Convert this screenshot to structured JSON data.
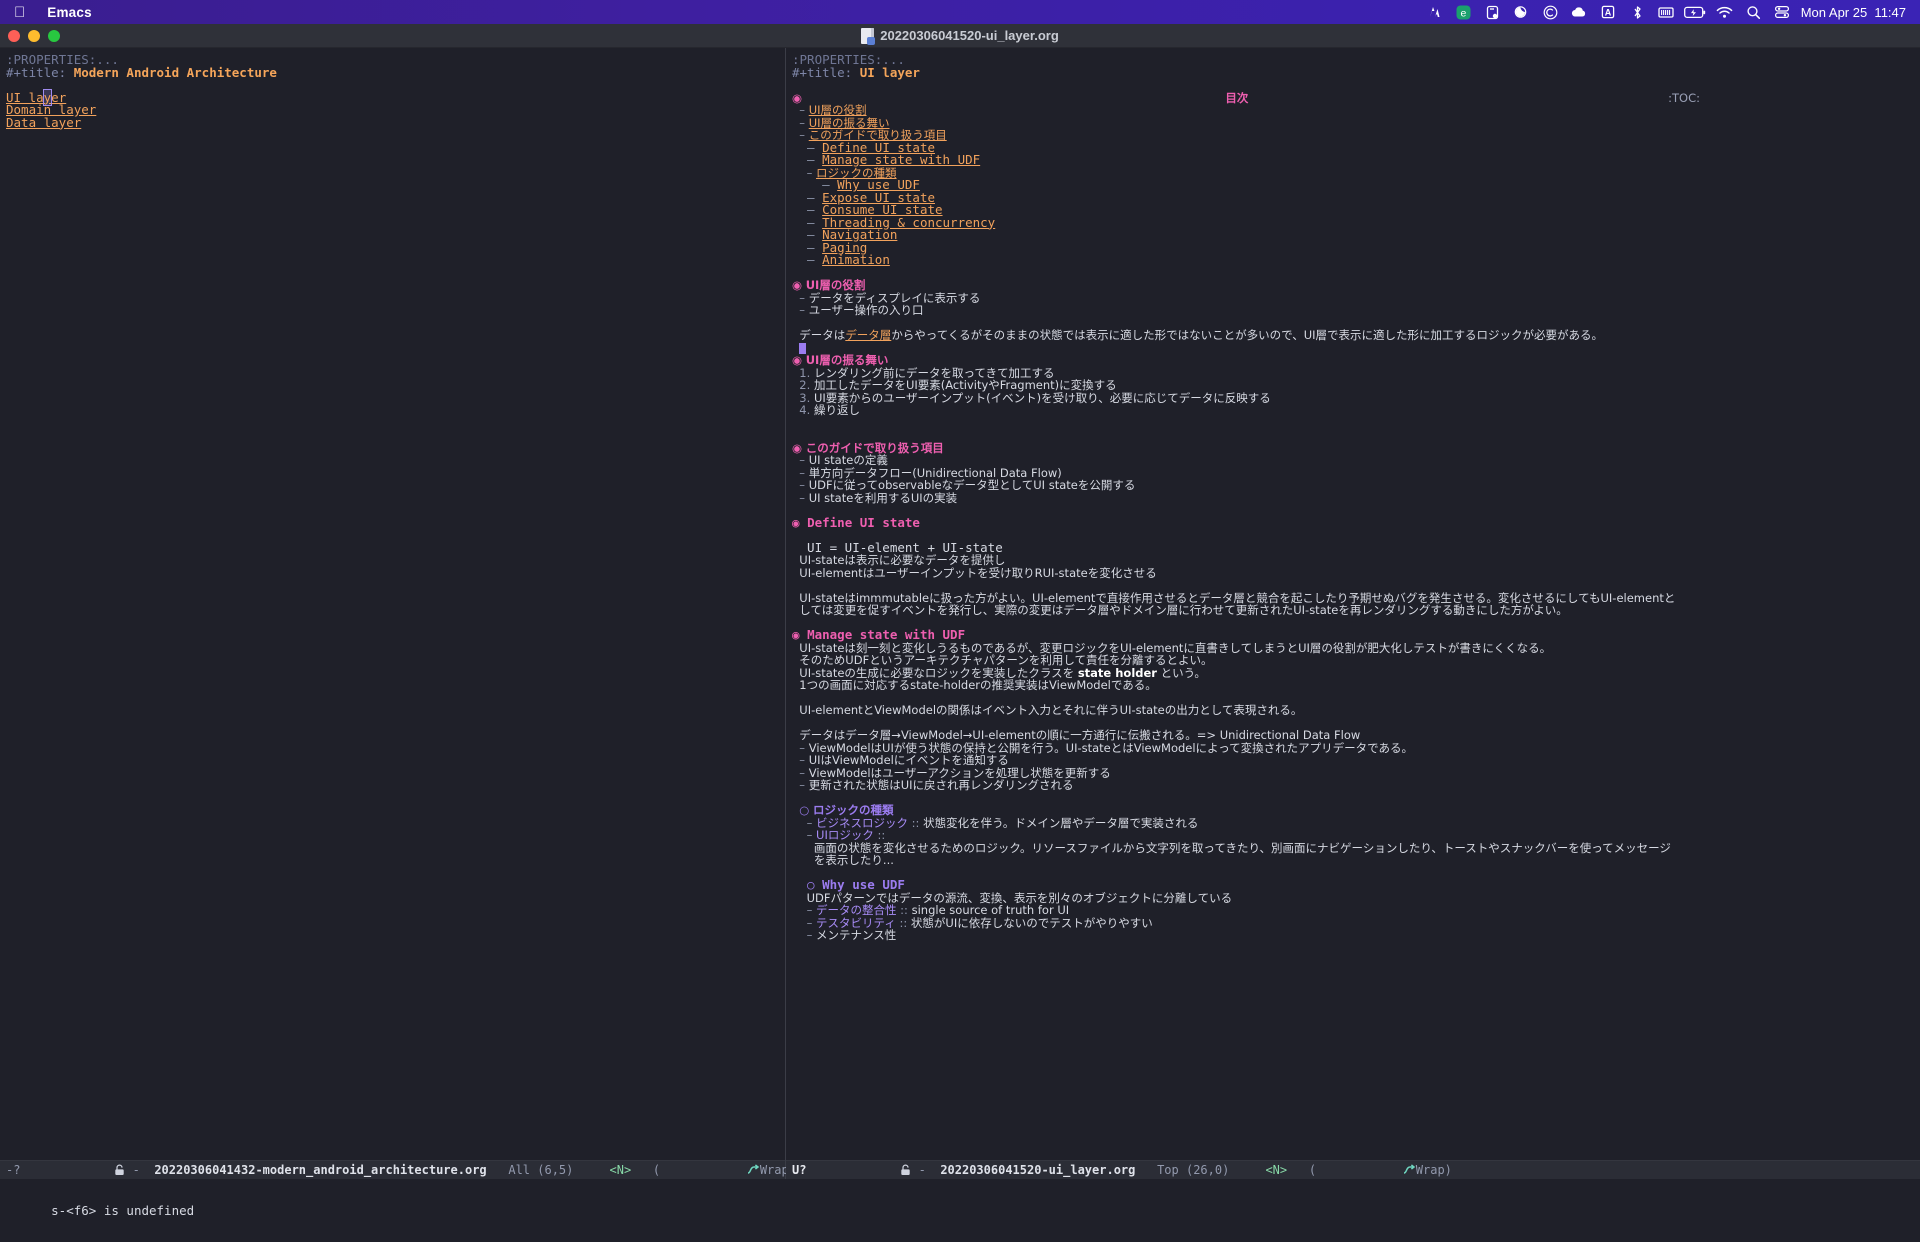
{
  "menubar": {
    "apple_glyph": "",
    "app_name": "Emacs",
    "tray_icons": [
      {
        "name": "sound-meter-icon",
        "glyph": "ᵚ"
      },
      {
        "name": "evernote-icon",
        "glyph": "e"
      },
      {
        "name": "clipboard-icon",
        "glyph": "▯"
      },
      {
        "name": "moon-icon",
        "glyph": "◖"
      },
      {
        "name": "creative-cloud-icon",
        "glyph": "Ⓒ"
      },
      {
        "name": "dropbox-icon",
        "glyph": "☁"
      },
      {
        "name": "input-source-icon",
        "glyph": "A"
      },
      {
        "name": "bluetooth-icon",
        "glyph": "✶"
      },
      {
        "name": "keyboard-brightness-icon",
        "glyph": "⌸"
      },
      {
        "name": "battery-icon",
        "glyph": "▭"
      },
      {
        "name": "wifi-icon",
        "glyph": "◠"
      },
      {
        "name": "spotlight-search-icon",
        "glyph": "⚲"
      },
      {
        "name": "control-center-icon",
        "glyph": "☰"
      }
    ],
    "clock": "Mon Apr 25  11:47"
  },
  "titlebar": {
    "title": "20220306041520-ui_layer.org",
    "traffic_lights": [
      "close",
      "minimize",
      "zoom"
    ]
  },
  "left_window": {
    "lines": [
      {
        "segs": [
          {
            "t": ":PROPERTIES:...",
            "c": "f-prop"
          }
        ]
      },
      {
        "segs": [
          {
            "t": "#+title: ",
            "c": "f-kw"
          },
          {
            "t": "Modern Android Architecture",
            "c": "f-title"
          }
        ]
      },
      {
        "segs": [
          {
            "t": "",
            "c": "f-plain"
          }
        ]
      },
      {
        "segs": [
          {
            "t": "UI la",
            "c": "f-link"
          },
          {
            "t": "y",
            "c": "f-link caret-box"
          },
          {
            "t": "er",
            "c": "f-link"
          }
        ]
      },
      {
        "segs": [
          {
            "t": "Domain layer",
            "c": "f-link"
          }
        ]
      },
      {
        "segs": [
          {
            "t": "Data layer",
            "c": "f-link"
          }
        ]
      }
    ],
    "modeline": {
      "flags": "-?",
      "lock": "🔓",
      "sep": "-",
      "buffer": "20220306041432-modern_android_architecture.org",
      "position": "All (6,5)",
      "evil_state": "<N>",
      "minor": "Wrap"
    }
  },
  "right_window": {
    "toc_marker": ":TOC:",
    "lines": [
      {
        "segs": [
          {
            "t": ":PROPERTIES:...",
            "c": "f-prop"
          }
        ]
      },
      {
        "segs": [
          {
            "t": "#+title: ",
            "c": "f-kw"
          },
          {
            "t": "UI layer",
            "c": "f-title"
          }
        ]
      },
      {
        "segs": [
          {
            "t": ""
          }
        ]
      },
      {
        "segs": [
          {
            "t": "◉ ",
            "c": "f-bullet"
          },
          {
            "t": "目次",
            "c": "f-h1"
          }
        ],
        "jp": true,
        "toc": true
      },
      {
        "segs": [
          {
            "t": "  – ",
            "c": "f-dash"
          },
          {
            "t": "UI層の役割",
            "c": "f-link"
          }
        ],
        "jp": true
      },
      {
        "segs": [
          {
            "t": "  – ",
            "c": "f-dash"
          },
          {
            "t": "UI層の振る舞い",
            "c": "f-link"
          }
        ],
        "jp": true
      },
      {
        "segs": [
          {
            "t": "  – ",
            "c": "f-dash"
          },
          {
            "t": "このガイドで取り扱う項目",
            "c": "f-link"
          }
        ],
        "jp": true
      },
      {
        "segs": [
          {
            "t": "  – ",
            "c": "f-dash"
          },
          {
            "t": "Define UI state",
            "c": "f-link"
          }
        ]
      },
      {
        "segs": [
          {
            "t": "  – ",
            "c": "f-dash"
          },
          {
            "t": "Manage state with UDF",
            "c": "f-link"
          }
        ]
      },
      {
        "segs": [
          {
            "t": "    – ",
            "c": "f-dash"
          },
          {
            "t": "ロジックの種類",
            "c": "f-link"
          }
        ],
        "jp": true
      },
      {
        "segs": [
          {
            "t": "    – ",
            "c": "f-dash"
          },
          {
            "t": "Why use UDF",
            "c": "f-link"
          }
        ]
      },
      {
        "segs": [
          {
            "t": "  – ",
            "c": "f-dash"
          },
          {
            "t": "Expose UI state",
            "c": "f-link"
          }
        ]
      },
      {
        "segs": [
          {
            "t": "  – ",
            "c": "f-dash"
          },
          {
            "t": "Consume UI state",
            "c": "f-link"
          }
        ]
      },
      {
        "segs": [
          {
            "t": "  – ",
            "c": "f-dash"
          },
          {
            "t": "Threading & concurrency",
            "c": "f-link"
          }
        ]
      },
      {
        "segs": [
          {
            "t": "  – ",
            "c": "f-dash"
          },
          {
            "t": "Navigation",
            "c": "f-link"
          }
        ]
      },
      {
        "segs": [
          {
            "t": "  – ",
            "c": "f-dash"
          },
          {
            "t": "Paging",
            "c": "f-link"
          }
        ]
      },
      {
        "segs": [
          {
            "t": "  – ",
            "c": "f-dash"
          },
          {
            "t": "Animation",
            "c": "f-link"
          }
        ]
      },
      {
        "segs": [
          {
            "t": ""
          }
        ]
      },
      {
        "segs": [
          {
            "t": "◉ ",
            "c": "f-bullet"
          },
          {
            "t": "UI層の役割",
            "c": "f-h1"
          }
        ],
        "jp": true
      },
      {
        "segs": [
          {
            "t": "  – ",
            "c": "f-dash"
          },
          {
            "t": "データをディスプレイに表示する",
            "c": "f-plain"
          }
        ],
        "jp": true
      },
      {
        "segs": [
          {
            "t": "  – ",
            "c": "f-dash"
          },
          {
            "t": "ユーザー操作の入り口",
            "c": "f-plain"
          }
        ],
        "jp": true
      },
      {
        "segs": [
          {
            "t": ""
          }
        ]
      },
      {
        "segs": [
          {
            "t": "  データは",
            "c": "f-plain"
          },
          {
            "t": "データ層",
            "c": "f-link"
          },
          {
            "t": "からやってくるがそのままの状態では表示に適した形ではないことが多いので、UI層で表示に適した形に加工するロジックが必要がある。",
            "c": "f-plain"
          }
        ],
        "jp": true
      },
      {
        "segs": [
          {
            "t": "  ",
            "c": "f-plain"
          },
          {
            "t": "█",
            "c": "cursor"
          }
        ],
        "jp": true
      },
      {
        "segs": [
          {
            "t": "◉ ",
            "c": "f-bullet"
          },
          {
            "t": "UI層の振る舞い",
            "c": "f-h1"
          }
        ],
        "jp": true
      },
      {
        "segs": [
          {
            "t": "  1. ",
            "c": "f-dash"
          },
          {
            "t": "レンダリング前にデータを取ってきて加工する",
            "c": "f-plain"
          }
        ],
        "jp": true
      },
      {
        "segs": [
          {
            "t": "  2. ",
            "c": "f-dash"
          },
          {
            "t": "加工したデータをUI要素(ActivityやFragment)に変換する",
            "c": "f-plain"
          }
        ],
        "jp": true
      },
      {
        "segs": [
          {
            "t": "  3. ",
            "c": "f-dash"
          },
          {
            "t": "UI要素からのユーザーインプット(イベント)を受け取り、必要に応じてデータに反映する",
            "c": "f-plain"
          }
        ],
        "jp": true
      },
      {
        "segs": [
          {
            "t": "  4. ",
            "c": "f-dash"
          },
          {
            "t": "繰り返し",
            "c": "f-plain"
          }
        ],
        "jp": true
      },
      {
        "segs": [
          {
            "t": ""
          }
        ]
      },
      {
        "segs": [
          {
            "t": ""
          }
        ]
      },
      {
        "segs": [
          {
            "t": "◉ ",
            "c": "f-bullet"
          },
          {
            "t": "このガイドで取り扱う項目",
            "c": "f-h1"
          }
        ],
        "jp": true
      },
      {
        "segs": [
          {
            "t": "  – ",
            "c": "f-dash"
          },
          {
            "t": "UI stateの定義",
            "c": "f-plain"
          }
        ],
        "jp": true
      },
      {
        "segs": [
          {
            "t": "  – ",
            "c": "f-dash"
          },
          {
            "t": "単方向データフロー(Unidirectional Data Flow)",
            "c": "f-plain"
          }
        ],
        "jp": true
      },
      {
        "segs": [
          {
            "t": "  – ",
            "c": "f-dash"
          },
          {
            "t": "UDFに従ってobservableなデータ型としてUI stateを公開する",
            "c": "f-plain"
          }
        ],
        "jp": true
      },
      {
        "segs": [
          {
            "t": "  – ",
            "c": "f-dash"
          },
          {
            "t": "UI stateを利用するUIの実装",
            "c": "f-plain"
          }
        ],
        "jp": true
      },
      {
        "segs": [
          {
            "t": ""
          }
        ]
      },
      {
        "segs": [
          {
            "t": "◉ ",
            "c": "f-bullet"
          },
          {
            "t": "Define UI state",
            "c": "f-h1"
          }
        ]
      },
      {
        "segs": [
          {
            "t": ""
          }
        ]
      },
      {
        "segs": [
          {
            "t": "  UI = UI-element + UI-state",
            "c": "f-plain"
          }
        ]
      },
      {
        "segs": [
          {
            "t": "  UI-stateは表示に必要なデータを提供し",
            "c": "f-plain"
          }
        ],
        "jp": true
      },
      {
        "segs": [
          {
            "t": "  UI-elementはユーザーインプットを受け取りRUI-stateを変化させる",
            "c": "f-plain"
          }
        ],
        "jp": true
      },
      {
        "segs": [
          {
            "t": ""
          }
        ]
      },
      {
        "segs": [
          {
            "t": "  UI-stateはimmmutableに扱った方がよい。UI-elementで直接作用させるとデータ層と競合を起こしたり予期せぬバグを発生させる。変化させるにしてもUI-elementと",
            "c": "f-plain"
          }
        ],
        "jp": true
      },
      {
        "segs": [
          {
            "t": "  しては変更を促すイベントを発行し、実際の変更はデータ層やドメイン層に行わせて更新されたUI-stateを再レンダリングする動きにした方がよい。",
            "c": "f-plain"
          }
        ],
        "jp": true
      },
      {
        "segs": [
          {
            "t": ""
          }
        ]
      },
      {
        "segs": [
          {
            "t": "◉ ",
            "c": "f-bullet"
          },
          {
            "t": "Manage state with UDF",
            "c": "f-h1"
          }
        ]
      },
      {
        "segs": [
          {
            "t": "  UI-stateは刻一刻と変化しうるものであるが、変更ロジックをUI-elementに直書きしてしまうとUI層の役割が肥大化しテストが書きにくくなる。",
            "c": "f-plain"
          }
        ],
        "jp": true
      },
      {
        "segs": [
          {
            "t": "  そのためUDFというアーキテクチャパターンを利用して責任を分離するとよい。",
            "c": "f-plain"
          }
        ],
        "jp": true
      },
      {
        "segs": [
          {
            "t": "  UI-stateの生成に必要なロジックを実装したクラスを ",
            "c": "f-plain"
          },
          {
            "t": "state holder",
            "c": "f-bold"
          },
          {
            "t": " という。",
            "c": "f-plain"
          }
        ],
        "jp": true
      },
      {
        "segs": [
          {
            "t": "  1つの画面に対応するstate-holderの推奨実装はViewModelである。",
            "c": "f-plain"
          }
        ],
        "jp": true
      },
      {
        "segs": [
          {
            "t": ""
          }
        ]
      },
      {
        "segs": [
          {
            "t": "  UI-elementとViewModelの関係はイベント入力とそれに伴うUI-stateの出力として表現される。",
            "c": "f-plain"
          }
        ],
        "jp": true
      },
      {
        "segs": [
          {
            "t": ""
          }
        ]
      },
      {
        "segs": [
          {
            "t": "  データはデータ層→ViewModel→UI-elementの順に一方通行に伝搬される。=> Unidirectional Data Flow",
            "c": "f-plain"
          }
        ],
        "jp": true
      },
      {
        "segs": [
          {
            "t": "  – ",
            "c": "f-dash"
          },
          {
            "t": "ViewModelはUIが使う状態の保持と公開を行う。UI-stateとはViewModelによって変換されたアプリデータである。",
            "c": "f-plain"
          }
        ],
        "jp": true
      },
      {
        "segs": [
          {
            "t": "  – ",
            "c": "f-dash"
          },
          {
            "t": "UIはViewModelにイベントを通知する",
            "c": "f-plain"
          }
        ],
        "jp": true
      },
      {
        "segs": [
          {
            "t": "  – ",
            "c": "f-dash"
          },
          {
            "t": "ViewModelはユーザーアクションを処理し状態を更新する",
            "c": "f-plain"
          }
        ],
        "jp": true
      },
      {
        "segs": [
          {
            "t": "  – ",
            "c": "f-dash"
          },
          {
            "t": "更新された状態はUIに戻され再レンダリングされる",
            "c": "f-plain"
          }
        ],
        "jp": true
      },
      {
        "segs": [
          {
            "t": ""
          }
        ]
      },
      {
        "segs": [
          {
            "t": "  ○ ",
            "c": "f-bullet2"
          },
          {
            "t": "ロジックの種類",
            "c": "f-h2"
          }
        ],
        "jp": true
      },
      {
        "segs": [
          {
            "t": "    – ",
            "c": "f-dash"
          },
          {
            "t": "ビジネスロジック",
            "c": "f-dterm"
          },
          {
            "t": " :: ",
            "c": "f-dash"
          },
          {
            "t": "状態変化を伴う。ドメイン層やデータ層で実装される",
            "c": "f-plain"
          }
        ],
        "jp": true
      },
      {
        "segs": [
          {
            "t": "    – ",
            "c": "f-dash"
          },
          {
            "t": "UIロジック",
            "c": "f-dterm"
          },
          {
            "t": " :: ",
            "c": "f-dash"
          }
        ],
        "jp": true
      },
      {
        "segs": [
          {
            "t": "      画面の状態を変化させるためのロジック。リソースファイルから文字列を取ってきたり、別画面にナビゲーションしたり、トーストやスナックバーを使ってメッセージ",
            "c": "f-plain"
          }
        ],
        "jp": true
      },
      {
        "segs": [
          {
            "t": "      を表示したり...",
            "c": "f-plain"
          }
        ],
        "jp": true
      },
      {
        "segs": [
          {
            "t": ""
          }
        ]
      },
      {
        "segs": [
          {
            "t": "  ○ ",
            "c": "f-bullet2"
          },
          {
            "t": "Why use UDF",
            "c": "f-h2"
          }
        ]
      },
      {
        "segs": [
          {
            "t": "    UDFパターンではデータの源流、変換、表示を別々のオブジェクトに分離している",
            "c": "f-plain"
          }
        ],
        "jp": true
      },
      {
        "segs": [
          {
            "t": "    – ",
            "c": "f-dash"
          },
          {
            "t": "データの整合性",
            "c": "f-dterm"
          },
          {
            "t": " :: ",
            "c": "f-dash"
          },
          {
            "t": "single source of truth for UI",
            "c": "f-plain"
          }
        ],
        "jp": true
      },
      {
        "segs": [
          {
            "t": "    – ",
            "c": "f-dash"
          },
          {
            "t": "テスタビリティ",
            "c": "f-dterm"
          },
          {
            "t": " :: ",
            "c": "f-dash"
          },
          {
            "t": "状態がUIに依存しないのでテストがやりやすい",
            "c": "f-plain"
          }
        ],
        "jp": true
      },
      {
        "segs": [
          {
            "t": "    – ",
            "c": "f-dash"
          },
          {
            "t": "メンテナンス性",
            "c": "f-plain"
          }
        ],
        "jp": true
      }
    ],
    "modeline": {
      "flags": "U?",
      "lock": "🔓",
      "sep": "-",
      "buffer": "20220306041520-ui_layer.org",
      "position": "Top (26,0)",
      "evil_state": "<N>",
      "minor": "Wrap"
    }
  },
  "echo_area": {
    "message": "s-<f6> is undefined"
  },
  "colors": {
    "background": "#1f2029",
    "modeline_bg": "#2b2d36",
    "heading1": "#ef5fb0",
    "heading2": "#9b7cf0",
    "link": "#f2a25c",
    "title": "#f5a55a",
    "menubar": "#3b21ad",
    "cursor": "#9b7cf0"
  }
}
